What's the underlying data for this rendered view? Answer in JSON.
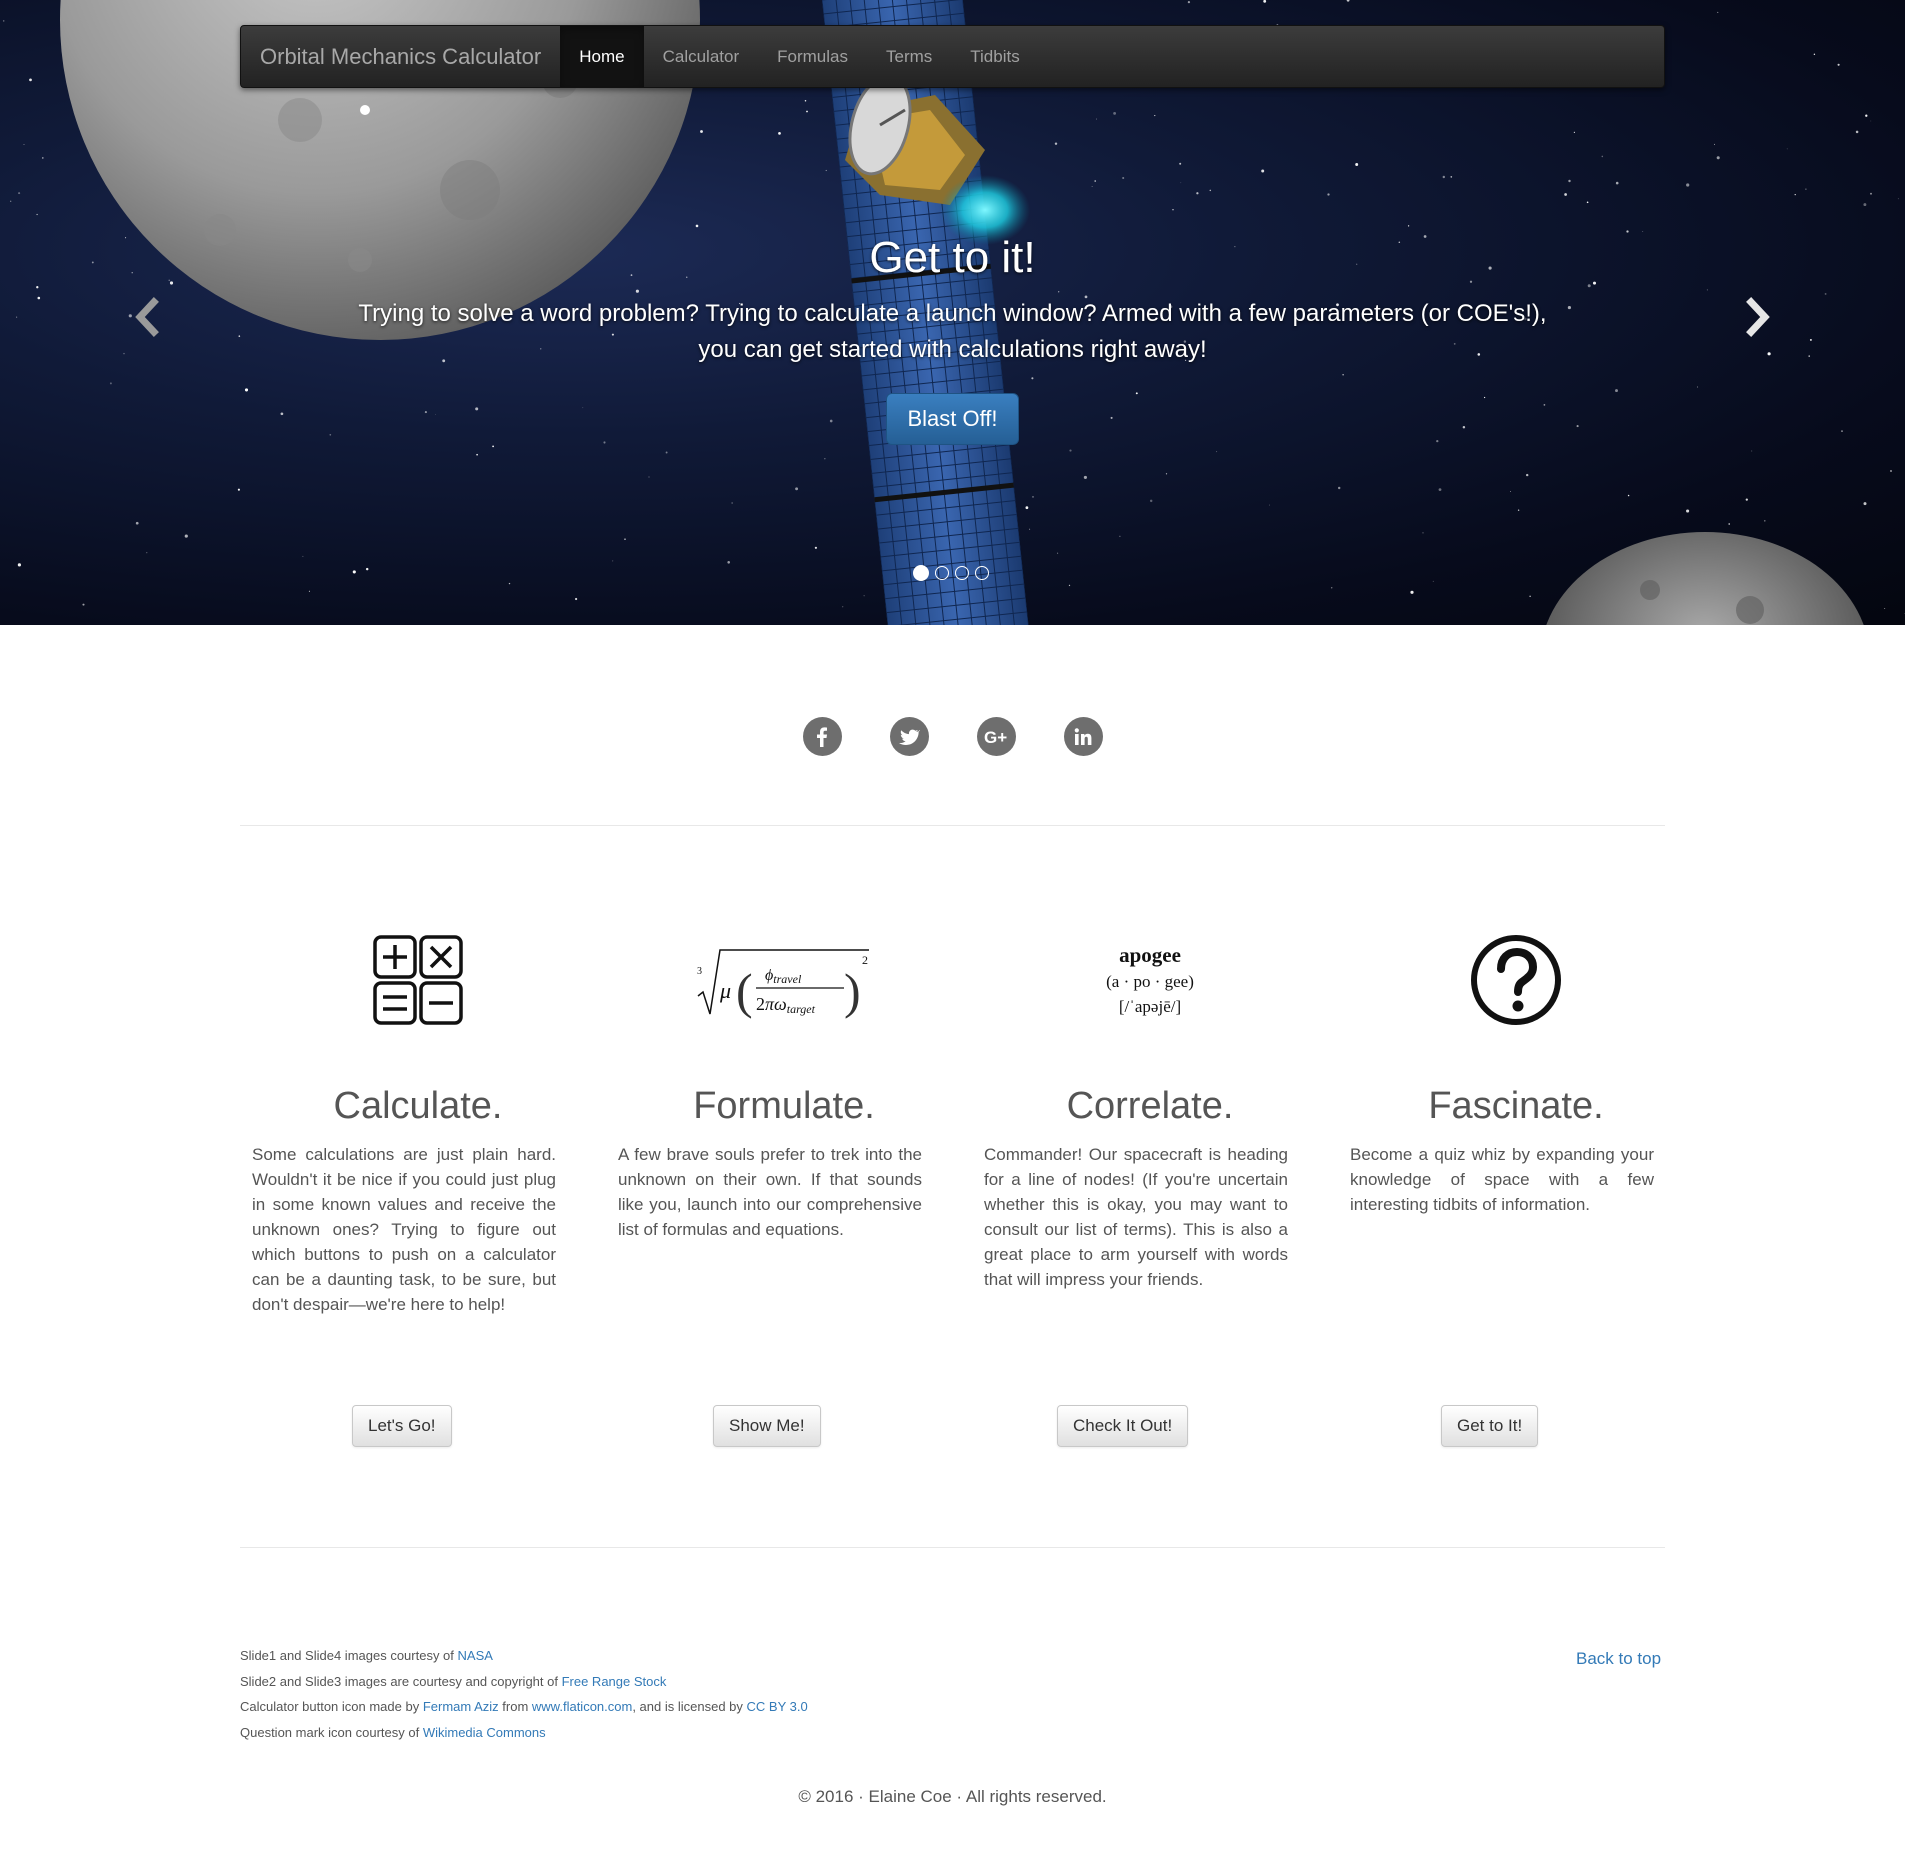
{
  "navbar": {
    "brand": "Orbital Mechanics Calculator",
    "items": [
      {
        "label": "Home",
        "active": true
      },
      {
        "label": "Calculator",
        "active": false
      },
      {
        "label": "Formulas",
        "active": false
      },
      {
        "label": "Terms",
        "active": false
      },
      {
        "label": "Tidbits",
        "active": false
      }
    ]
  },
  "carousel": {
    "heading": "Get to it!",
    "text": "Trying to solve a word problem? Trying to calculate a launch window? Armed with a few parameters (or COE's!), you can get started with calculations right away!",
    "button": "Blast Off!",
    "slide_count": 4,
    "active_slide": 1,
    "prev_icon": "chevron-left-icon",
    "next_icon": "chevron-right-icon"
  },
  "social": [
    {
      "name": "facebook",
      "icon": "facebook-icon"
    },
    {
      "name": "twitter",
      "icon": "twitter-icon"
    },
    {
      "name": "google-plus",
      "icon": "google-plus-icon"
    },
    {
      "name": "linkedin",
      "icon": "linkedin-icon"
    }
  ],
  "features": [
    {
      "icon": "calculator-icon",
      "title": "Calculate.",
      "text": "Some calculations are just plain hard. Wouldn't it be nice if you could just plug in some known values and receive the unknown ones? Trying to figure out which buttons to push on a calculator can be a daunting task, to be sure, but don't despair—we're here to help!",
      "button": "Let's Go!"
    },
    {
      "icon": "formula-icon",
      "title": "Formulate.",
      "text": "A few brave souls prefer to trek into the unknown on their own. If that sounds like you, launch into our comprehensive list of formulas and equations.",
      "button": "Show Me!"
    },
    {
      "icon": "apogee-definition",
      "title": "Correlate.",
      "text": "Commander! Our spacecraft is heading for a line of nodes! (If you're uncertain whether this is okay, you may want to consult our list of terms). This is also a great place to arm yourself with words that will impress your friends.",
      "button": "Check It Out!"
    },
    {
      "icon": "question-mark-icon",
      "title": "Fascinate.",
      "text": "Become a quiz whiz by expanding your knowledge of space with a few interesting tidbits of information.",
      "button": "Get to It!"
    }
  ],
  "apogee": {
    "word": "apogee",
    "syllables": "(a · po · gee)",
    "pronunciation": "[/ˈapəjē/]"
  },
  "footer": {
    "credits": [
      {
        "pre": "Slide1 and Slide4 images courtesy of ",
        "link1": "NASA"
      },
      {
        "pre": "Slide2 and Slide3 images are courtesy and copyright of ",
        "link1": "Free Range Stock"
      },
      {
        "pre": "Calculator button icon made by ",
        "link1": "Fermam Aziz",
        "mid": " from ",
        "link2": "www.flaticon.com",
        "mid2": ", and is licensed by ",
        "link3": "CC BY 3.0"
      },
      {
        "pre": "Question mark icon courtesy of ",
        "link1": "Wikimedia Commons"
      }
    ],
    "back_to_top": "Back to top",
    "copyright": "© 2016 · Elaine Coe · All rights reserved."
  }
}
